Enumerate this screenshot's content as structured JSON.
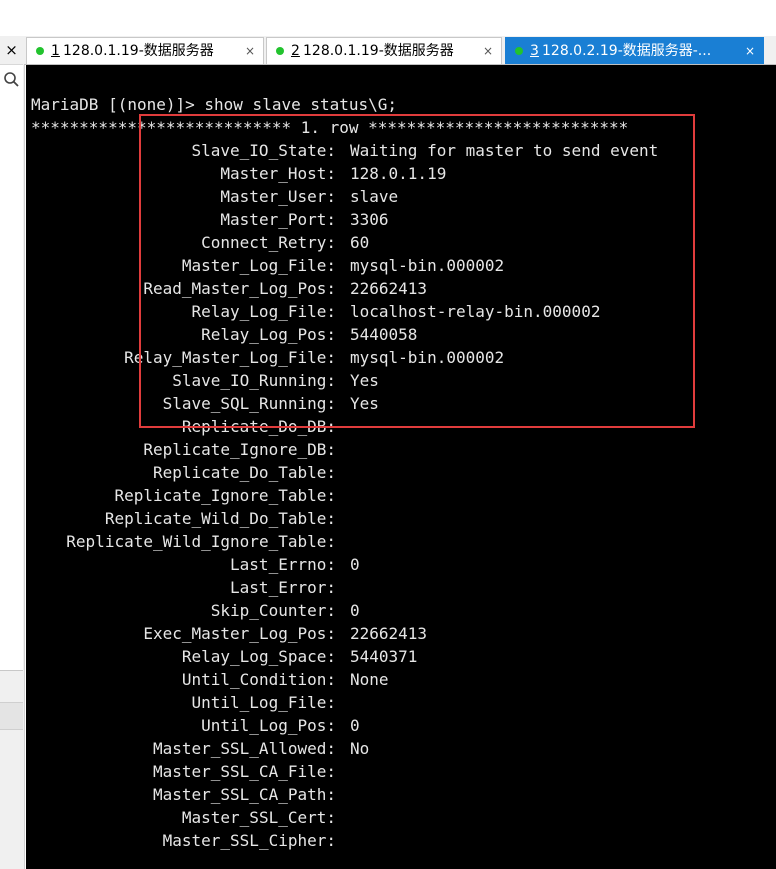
{
  "left_panel": {
    "close_glyph": "×"
  },
  "tabs": [
    {
      "num": "1",
      "title": "128.0.1.19-数据服务器",
      "close": "×",
      "active": false
    },
    {
      "num": "2",
      "title": "128.0.1.19-数据服务器",
      "close": "×",
      "active": false
    },
    {
      "num": "3",
      "title": "128.0.2.19-数据服务器-...",
      "close": "×",
      "active": true
    }
  ],
  "colors": {
    "terminal_bg": "#000000",
    "terminal_text": "#e6e6e6",
    "tab_active": "#1a7fd4",
    "status_dot": "#22c32e",
    "highlight": "#e03c3c"
  },
  "terminal": {
    "prompt_line": "MariaDB [(none)]> show slave status\\G;",
    "row_header": "*************************** 1. row ***************************",
    "fields": [
      {
        "label": "Slave_IO_State:",
        "value": "Waiting for master to send event"
      },
      {
        "label": "Master_Host:",
        "value": "128.0.1.19"
      },
      {
        "label": "Master_User:",
        "value": "slave"
      },
      {
        "label": "Master_Port:",
        "value": "3306"
      },
      {
        "label": "Connect_Retry:",
        "value": "60"
      },
      {
        "label": "Master_Log_File:",
        "value": "mysql-bin.000002"
      },
      {
        "label": "Read_Master_Log_Pos:",
        "value": "22662413"
      },
      {
        "label": "Relay_Log_File:",
        "value": "localhost-relay-bin.000002"
      },
      {
        "label": "Relay_Log_Pos:",
        "value": "5440058"
      },
      {
        "label": "Relay_Master_Log_File:",
        "value": "mysql-bin.000002"
      },
      {
        "label": "Slave_IO_Running:",
        "value": "Yes"
      },
      {
        "label": "Slave_SQL_Running:",
        "value": "Yes"
      },
      {
        "label": "Replicate_Do_DB:",
        "value": ""
      },
      {
        "label": "Replicate_Ignore_DB:",
        "value": ""
      },
      {
        "label": "Replicate_Do_Table:",
        "value": ""
      },
      {
        "label": "Replicate_Ignore_Table:",
        "value": ""
      },
      {
        "label": "Replicate_Wild_Do_Table:",
        "value": ""
      },
      {
        "label": "Replicate_Wild_Ignore_Table:",
        "value": ""
      },
      {
        "label": "Last_Errno:",
        "value": "0"
      },
      {
        "label": "Last_Error:",
        "value": ""
      },
      {
        "label": "Skip_Counter:",
        "value": "0"
      },
      {
        "label": "Exec_Master_Log_Pos:",
        "value": "22662413"
      },
      {
        "label": "Relay_Log_Space:",
        "value": "5440371"
      },
      {
        "label": "Until_Condition:",
        "value": "None"
      },
      {
        "label": "Until_Log_File:",
        "value": ""
      },
      {
        "label": "Until_Log_Pos:",
        "value": "0"
      },
      {
        "label": "Master_SSL_Allowed:",
        "value": "No"
      },
      {
        "label": "Master_SSL_CA_File:",
        "value": ""
      },
      {
        "label": "Master_SSL_CA_Path:",
        "value": ""
      },
      {
        "label": "Master_SSL_Cert:",
        "value": ""
      },
      {
        "label": "Master_SSL_Cipher:",
        "value": ""
      }
    ]
  }
}
